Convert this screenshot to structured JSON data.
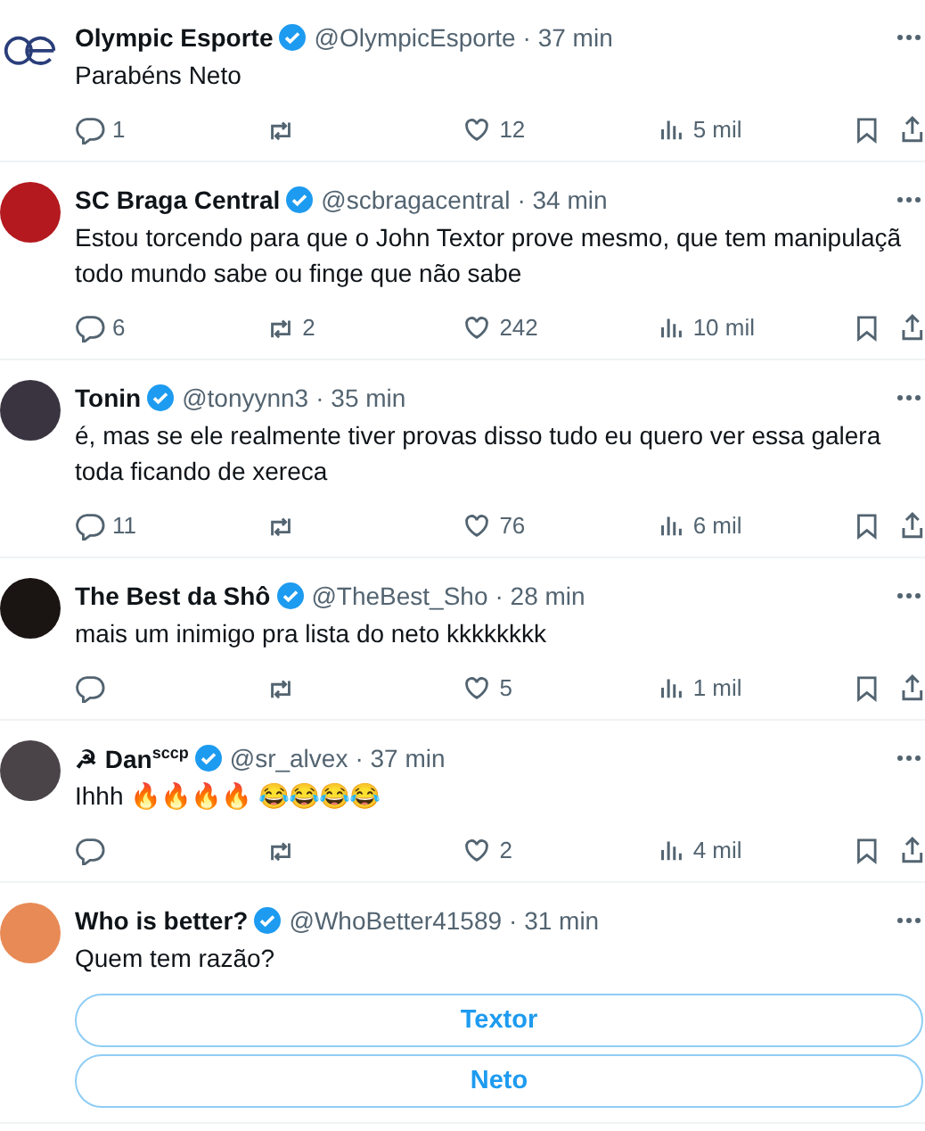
{
  "tweets": [
    {
      "name": "Olympic Esporte",
      "verified": true,
      "handle": "@OlympicEsporte",
      "time": "· 37 min",
      "avatar": {
        "kind": "logo"
      },
      "text": "Parabéns Neto",
      "replies": "1",
      "likes": "12",
      "views": "5 mil"
    },
    {
      "name": "SC Braga Central",
      "verified": true,
      "handle": "@scbragacentral",
      "time": "· 34 min",
      "avatar": {
        "kind": "photo",
        "color": "#b3191e"
      },
      "text": "Estou torcendo para que o John Textor prove mesmo, que tem manipulaçã\ntodo mundo sabe ou finge que não sabe",
      "replies": "6",
      "retweets": "2",
      "likes": "242",
      "views": "10 mil"
    },
    {
      "name": "Tonin",
      "verified": true,
      "handle": "@tonyynn3",
      "time": "· 35 min",
      "avatar": {
        "kind": "photo",
        "color": "#3a3440"
      },
      "text": "é, mas se ele realmente tiver provas disso tudo eu quero ver essa galera\ntoda ficando de xereca",
      "replies": "11",
      "likes": "76",
      "views": "6 mil"
    },
    {
      "name": "The Best da Shô",
      "verified": true,
      "handle": "@TheBest_Sho",
      "time": "· 28 min",
      "avatar": {
        "kind": "photo",
        "color": "#1a1412"
      },
      "text": "mais um inimigo pra lista do neto kkkkkkkk",
      "likes": "5",
      "views": "1 mil"
    },
    {
      "name": "☭ Dan$^{sccp}$",
      "verified": true,
      "handle": "@sr_alvex",
      "time": "· 37 min",
      "avatar": {
        "kind": "photo",
        "color": "#4a4448"
      },
      "text": "Ihhh 🔥🔥🔥🔥 😂😂😂😂",
      "likes": "2",
      "views": "4 mil"
    },
    {
      "name": "Who is better?",
      "verified": true,
      "handle": "@WhoBetter41589",
      "time": "· 31 min",
      "avatar": {
        "kind": "photo",
        "color": "#e88a55"
      },
      "text": "Quem tem razão?",
      "poll": [
        "Textor",
        "Neto"
      ]
    }
  ]
}
